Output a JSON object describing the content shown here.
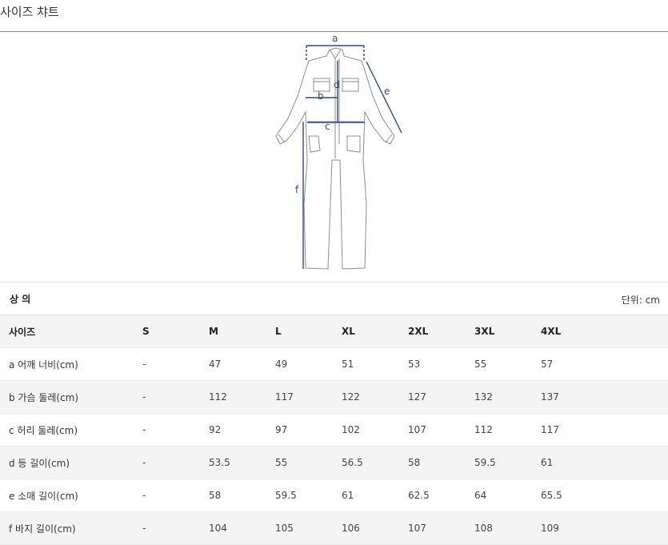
{
  "page_title": "사이즈 챠트",
  "diagram": {
    "labels": {
      "a": "a",
      "b": "b",
      "c": "c",
      "d": "d",
      "e": "e",
      "f": "f"
    },
    "line_color": "#2b4b8c",
    "garment_color": "#8c8c8c"
  },
  "section": {
    "title": "상 의",
    "unit": "단위: cm"
  },
  "table": {
    "headers": [
      "사이즈",
      "S",
      "M",
      "L",
      "XL",
      "2XL",
      "3XL",
      "4XL"
    ],
    "rows": [
      [
        "a 어깨 너비(cm)",
        "-",
        "47",
        "49",
        "51",
        "53",
        "55",
        "57"
      ],
      [
        "b 가슴 둘레(cm)",
        "-",
        "112",
        "117",
        "122",
        "127",
        "132",
        "137"
      ],
      [
        "c 허리 둘레(cm)",
        "-",
        "92",
        "97",
        "102",
        "107",
        "112",
        "117"
      ],
      [
        "d 등 길이(cm)",
        "-",
        "53.5",
        "55",
        "56.5",
        "58",
        "59.5",
        "61"
      ],
      [
        "e 소매 길이(cm)",
        "-",
        "58",
        "59.5",
        "61",
        "62.5",
        "64",
        "65.5"
      ],
      [
        "f 바지 길이(cm)",
        "-",
        "104",
        "105",
        "106",
        "107",
        "108",
        "109"
      ]
    ]
  }
}
